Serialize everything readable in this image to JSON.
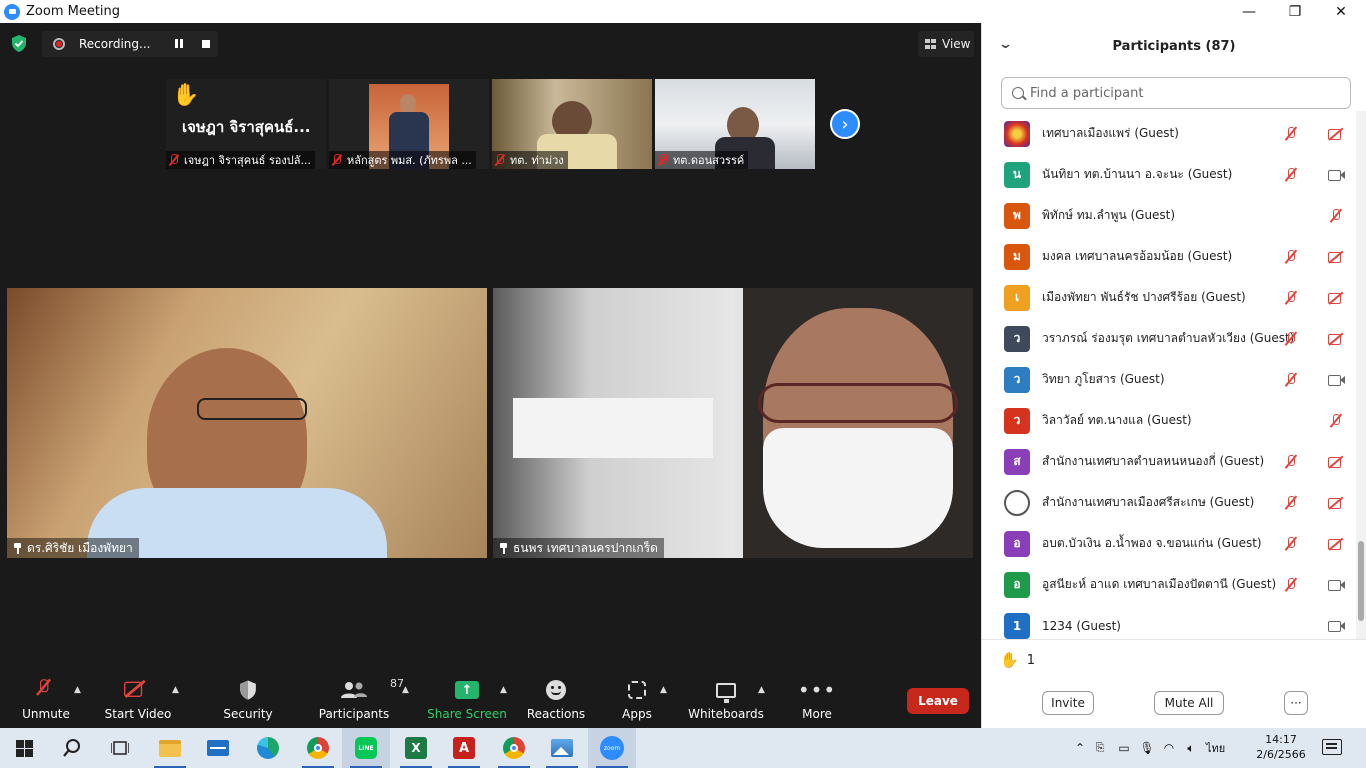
{
  "window": {
    "title": "Zoom Meeting"
  },
  "meeting": {
    "recording_label": "Recording...",
    "view_label": "View",
    "thumbnails": [
      {
        "name_big": "เจษฎา จิราสุคนธ์...",
        "label": "เจษฎา จิราสุคนธ์ รองปลั..."
      },
      {
        "label": "หลักสูตร พมส. (ภัทรพล ..."
      },
      {
        "label": "ทต. ท่าม่วง"
      },
      {
        "label": "ทต.ดอนสวรรค์"
      }
    ],
    "tiles": [
      {
        "label": "ดร.ศิริชัย เมืองพัทยา"
      },
      {
        "label": "ธนพร เทศบาลนครปากเกร็ด"
      }
    ]
  },
  "toolbar": {
    "unmute": "Unmute",
    "start_video": "Start Video",
    "security": "Security",
    "participants": "Participants",
    "participants_count": "87",
    "share_screen": "Share Screen",
    "reactions": "Reactions",
    "apps": "Apps",
    "whiteboards": "Whiteboards",
    "more": "More",
    "leave": "Leave"
  },
  "panel": {
    "title": "Participants (87)",
    "search_placeholder": "Find a participant",
    "participants": [
      {
        "avatar": "",
        "avatar_color": "#d6331f",
        "name": "เทศบาลเมืองแพร่ (Guest)",
        "mic": "muted",
        "cam": "off"
      },
      {
        "avatar": "น",
        "avatar_color": "#1fa37a",
        "name": "นันทิยา ทต.บ้านนา อ.จะนะ (Guest)",
        "mic": "muted",
        "cam": "on"
      },
      {
        "avatar": "พ",
        "avatar_color": "#d9560f",
        "name": "พิทักษ์ ทม.ลำพูน (Guest)",
        "mic": "",
        "cam": "mic-only"
      },
      {
        "avatar": "ม",
        "avatar_color": "#d9560f",
        "name": "มงคล เทศบาลนครอ้อมน้อย (Guest)",
        "mic": "muted",
        "cam": "off"
      },
      {
        "avatar": "เ",
        "avatar_color": "#f0a020",
        "name": "เมืองพัทยา  พันธ์รัช ปางศรีร้อย (Guest)",
        "mic": "muted",
        "cam": "off"
      },
      {
        "avatar": "ว",
        "avatar_color": "#3e4a5c",
        "name": "วราภรณ์  ร่องมรุต เทศบาลตำบลหัวเวียง (Guest)",
        "mic": "muted",
        "cam": "off"
      },
      {
        "avatar": "ว",
        "avatar_color": "#2e7cc2",
        "name": "วิทยา ภูโยสาร (Guest)",
        "mic": "muted",
        "cam": "on"
      },
      {
        "avatar": "ว",
        "avatar_color": "#d6331f",
        "name": "วิลาวัลย์ ทต.นางแล (Guest)",
        "mic": "",
        "cam": "mic-only"
      },
      {
        "avatar": "ส",
        "avatar_color": "#8a3fb8",
        "name": "สำนักงานเทศบาลตำบลหนหนองกี่ (Guest)",
        "mic": "muted",
        "cam": "off"
      },
      {
        "avatar": "",
        "avatar_color": "#ffffff",
        "name": "สำนักงานเทศบาลเมืองศรีสะเกษ (Guest)",
        "mic": "muted",
        "cam": "off"
      },
      {
        "avatar": "อ",
        "avatar_color": "#8a3fb8",
        "name": "อบต.บัวเงิน อ.น้ำพอง จ.ขอนแก่น (Guest)",
        "mic": "muted",
        "cam": "off"
      },
      {
        "avatar": "อ",
        "avatar_color": "#1f9a4a",
        "name": "อูสนียะห์ อาแด เทศบาลเมืองปัตตานี (Guest)",
        "mic": "muted",
        "cam": "on"
      },
      {
        "avatar": "1",
        "avatar_color": "#1f6fc4",
        "name": "1234 (Guest)",
        "mic": "",
        "cam": "on"
      }
    ],
    "raised_hands_count": "1",
    "invite": "Invite",
    "mute_all": "Mute All",
    "more": "···"
  },
  "taskbar": {
    "apps": [
      "start-icon",
      "search-icon",
      "task-view-icon",
      "file-explorer-icon",
      "mail-icon",
      "edge-icon",
      "chrome-icon",
      "line-icon",
      "excel-icon",
      "acrobat-icon",
      "chrome-icon",
      "photos-icon",
      "zoom-icon"
    ],
    "language": "ไทย",
    "time": "14:17",
    "date": "2/6/2566"
  }
}
